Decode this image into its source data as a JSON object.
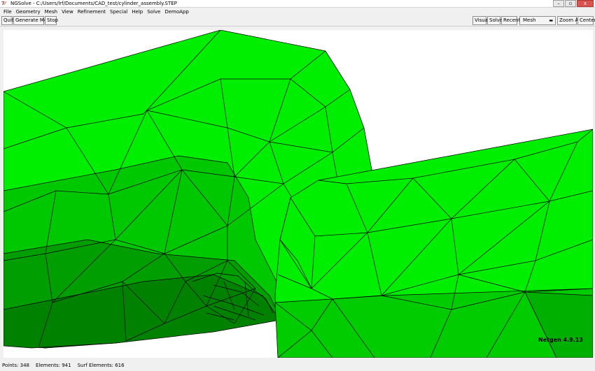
{
  "window": {
    "title": "NGSolve - C:/Users/lrf/Documents/CAD_test/cylinder_assembly.STEP",
    "icon": "netgen-icon",
    "minimize": "–",
    "maximize": "▫",
    "close": "x"
  },
  "menu": [
    "File",
    "Geometry",
    "Mesh",
    "View",
    "Refinement",
    "Special",
    "Help",
    "Solve",
    "DemoApp"
  ],
  "toolbar": {
    "left": [
      "Quit",
      "Generate Mesh",
      "Stop"
    ],
    "right": [
      "Visual",
      "Solve",
      "Recent"
    ],
    "mode_select": "Mesh",
    "zoom_all": "Zoom All",
    "center": "Center"
  },
  "viewport": {
    "watermark": "Netgen 4.9.13",
    "mesh_color": "#00ee00",
    "edge_color": "#000000"
  },
  "status": {
    "points": "Points:  348",
    "elements": "Elements:  941",
    "surf_elements": "Surf Elements:  616"
  }
}
